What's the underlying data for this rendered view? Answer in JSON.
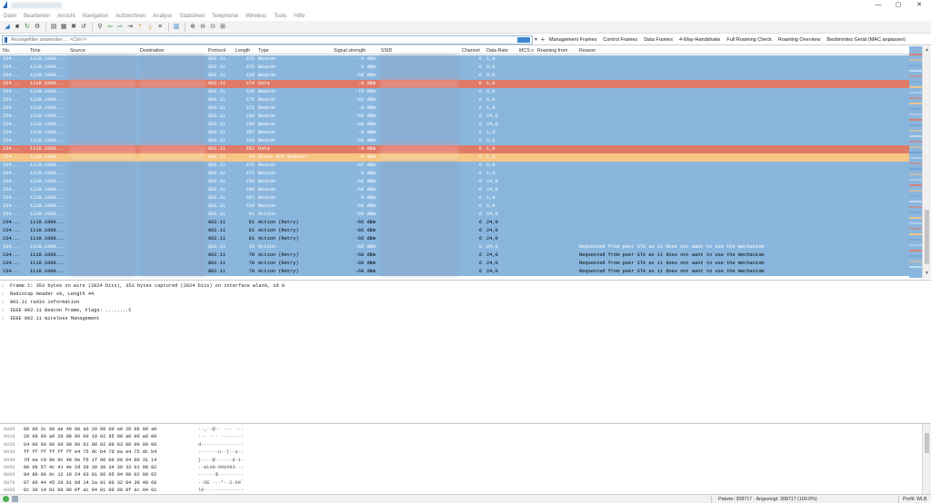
{
  "window": {
    "controls": {
      "minimize": "—",
      "maximize": "▢",
      "close": "✕"
    }
  },
  "menu": [
    "Datei",
    "Bearbeiten",
    "Ansicht",
    "Navigation",
    "Aufzeichnen",
    "Analyse",
    "Statistiken",
    "Telephonie",
    "Wireless",
    "Tools",
    "Hilfe"
  ],
  "toolbar": {
    "icons": [
      "shark-fin-icon",
      "stop-icon",
      "restart-icon",
      "options-gear-icon",
      "open-file-icon",
      "save-file-icon",
      "close-file-icon",
      "reload-icon",
      "find-icon",
      "go-back-icon",
      "go-forward-icon",
      "go-to-packet-icon",
      "go-first-icon",
      "go-last-icon",
      "autoscroll-icon",
      "colorize-icon",
      "zoom-in-icon",
      "zoom-out-icon",
      "zoom-reset-icon",
      "resize-columns-icon"
    ],
    "glyphs": [
      "◢",
      "■",
      "↻",
      "⚙",
      "▤",
      "▦",
      "✖",
      "↺",
      "⚲",
      "⇦",
      "⇨",
      "⇥",
      "⤒",
      "⤓",
      "≡",
      "▥",
      "⊕",
      "⊖",
      "⊙",
      "⊞"
    ]
  },
  "filter": {
    "placeholder": "Anzeigefilter anwenden ... <Ctrl-/>",
    "dropdown": "▾",
    "add": "+",
    "buttons": [
      "Management Frames",
      "Control Frames",
      "Data Frames",
      "4-Way-Handshake",
      "Full Roaming Check",
      "Roaming Overview",
      "Bestimmtes Gerät (MAC anpassen)"
    ]
  },
  "columns": [
    "No.",
    "Time",
    "Source",
    "Destination",
    "Protocol",
    "Length",
    "Type",
    "Signal strength",
    "SSID",
    "Channel",
    "Data Rate",
    "MCS x",
    "Roaming from",
    "Reason"
  ],
  "colors": {
    "light_blue_bg": "#8ab6de",
    "light_blue_fg": "#ffffff",
    "red_bg": "#e07a68",
    "red_fg": "#ffffff",
    "orange_bg": "#f6c583",
    "orange_fg": "#ffffff",
    "dark_blue_bg": "#8ab6de",
    "dark_blue_fg": "#000000"
  },
  "packets": [
    {
      "no": "234...",
      "time": "1118.1000...",
      "proto": "802.11",
      "len": "372",
      "type": "Beacon",
      "sig": "-6 dBm",
      "ch": "6",
      "rate": "1,0",
      "reason": "",
      "style": "light_blue"
    },
    {
      "no": "234...",
      "time": "1118.1000...",
      "proto": "802.11",
      "len": "375",
      "type": "Beacon",
      "sig": "-0 dBm",
      "ch": "6",
      "rate": "6,0",
      "reason": "",
      "style": "light_blue"
    },
    {
      "no": "234...",
      "time": "1118.1000...",
      "proto": "802.11",
      "len": "319",
      "type": "Beacon",
      "sig": "-66 dBm",
      "ch": "6",
      "rate": "6,0",
      "reason": "",
      "style": "light_blue"
    },
    {
      "no": "234...",
      "time": "1118.1000...",
      "proto": "802.11",
      "len": "174",
      "type": "Data",
      "sig": "-0 dBm",
      "ch": "6",
      "rate": "1,0",
      "reason": "",
      "style": "red"
    },
    {
      "no": "234...",
      "time": "1118.1000...",
      "proto": "802.11",
      "len": "328",
      "type": "Beacon",
      "sig": "-75 dBm",
      "ch": "6",
      "rate": "6,0",
      "reason": "",
      "style": "light_blue"
    },
    {
      "no": "234...",
      "time": "1118.1000...",
      "proto": "802.11",
      "len": "375",
      "type": "Beacon",
      "sig": "-82 dBm",
      "ch": "6",
      "rate": "6,0",
      "reason": "",
      "style": "light_blue"
    },
    {
      "no": "234...",
      "time": "1118.1000...",
      "proto": "802.11",
      "len": "371",
      "type": "Beacon",
      "sig": "-0 dBm",
      "ch": "6",
      "rate": "1,0",
      "reason": "",
      "style": "light_blue"
    },
    {
      "no": "234...",
      "time": "1118.1000...",
      "proto": "802.11",
      "len": "258",
      "type": "Beacon",
      "sig": "-66 dBm",
      "ch": "6",
      "rate": "24,0",
      "reason": "",
      "style": "light_blue"
    },
    {
      "no": "234...",
      "time": "1118.1000...",
      "proto": "802.11",
      "len": "298",
      "type": "Beacon",
      "sig": "-68 dBm",
      "ch": "6",
      "rate": "24,0",
      "reason": "",
      "style": "light_blue"
    },
    {
      "no": "234...",
      "time": "1118.1000...",
      "proto": "802.11",
      "len": "387",
      "type": "Beacon",
      "sig": "-0 dBm",
      "ch": "6",
      "rate": "1,0",
      "reason": "",
      "style": "light_blue"
    },
    {
      "no": "234...",
      "time": "1118.1000...",
      "proto": "802.11",
      "len": "319",
      "type": "Beacon",
      "sig": "-66 dBm",
      "ch": "6",
      "rate": "6,0",
      "reason": "",
      "style": "light_blue"
    },
    {
      "no": "234...",
      "time": "1118.1000...",
      "proto": "802.11",
      "len": "252",
      "type": "Data",
      "sig": "-0 dBm",
      "ch": "6",
      "rate": "1,0",
      "reason": "",
      "style": "red"
    },
    {
      "no": "234...",
      "time": "1118.1000...",
      "proto": "802.11",
      "len": "44",
      "type": "Block Ack Request",
      "sig": "-0 dBm",
      "ch": "6",
      "rate": "1,0",
      "reason": "",
      "style": "orange"
    },
    {
      "no": "234...",
      "time": "1118.1000...",
      "proto": "802.11",
      "len": "375",
      "type": "Beacon",
      "sig": "-82 dBm",
      "ch": "6",
      "rate": "6,0",
      "reason": "",
      "style": "light_blue"
    },
    {
      "no": "234...",
      "time": "1118.1000...",
      "proto": "802.11",
      "len": "371",
      "type": "Beacon",
      "sig": "-0 dBm",
      "ch": "6",
      "rate": "1,0",
      "reason": "",
      "style": "light_blue"
    },
    {
      "no": "234...",
      "time": "1118.1000...",
      "proto": "802.11",
      "len": "258",
      "type": "Beacon",
      "sig": "-66 dBm",
      "ch": "6",
      "rate": "24,0",
      "reason": "",
      "style": "light_blue"
    },
    {
      "no": "234...",
      "time": "1118.1000...",
      "proto": "802.11",
      "len": "298",
      "type": "Beacon",
      "sig": "-68 dBm",
      "ch": "6",
      "rate": "24,0",
      "reason": "",
      "style": "light_blue"
    },
    {
      "no": "234...",
      "time": "1118.1000...",
      "proto": "802.11",
      "len": "387",
      "type": "Beacon",
      "sig": "-0 dBm",
      "ch": "6",
      "rate": "1,0",
      "reason": "",
      "style": "light_blue"
    },
    {
      "no": "234...",
      "time": "1118.1000...",
      "proto": "802.11",
      "len": "319",
      "type": "Beacon",
      "sig": "-66 dBm",
      "ch": "6",
      "rate": "6,0",
      "reason": "",
      "style": "light_blue"
    },
    {
      "no": "234...",
      "time": "1118.1000...",
      "proto": "802.11",
      "len": "81",
      "type": "Action",
      "sig": "-66 dBm",
      "ch": "6",
      "rate": "24,0",
      "reason": "",
      "style": "light_blue"
    },
    {
      "no": "234...",
      "time": "1118.1000...",
      "proto": "802.11",
      "len": "81",
      "type": "Action (Retry)",
      "sig": "-66 dBm",
      "ch": "6",
      "rate": "24,0",
      "reason": "",
      "style": "dark_blue"
    },
    {
      "no": "234...",
      "time": "1118.1000...",
      "proto": "802.11",
      "len": "81",
      "type": "Action (Retry)",
      "sig": "-66 dBm",
      "ch": "6",
      "rate": "24,0",
      "reason": "",
      "style": "dark_blue"
    },
    {
      "no": "234...",
      "time": "1118.1000...",
      "proto": "802.11",
      "len": "81",
      "type": "Action (Retry)",
      "sig": "-66 dBm",
      "ch": "6",
      "rate": "24,0",
      "reason": "",
      "style": "dark_blue"
    },
    {
      "no": "234...",
      "time": "1118.1000...",
      "proto": "802.11",
      "len": "78",
      "type": "Action",
      "sig": "-66 dBm",
      "ch": "6",
      "rate": "24,0",
      "reason": "Requested from peer STA as it does not want to use the mechanism",
      "style": "light_blue"
    },
    {
      "no": "234...",
      "time": "1118.1000...",
      "proto": "802.11",
      "len": "78",
      "type": "Action (Retry)",
      "sig": "-68 dBm",
      "ch": "6",
      "rate": "24,0",
      "reason": "Requested from peer STA as it does not want to use the mechanism",
      "style": "dark_blue"
    },
    {
      "no": "234...",
      "time": "1118.1000...",
      "proto": "802.11",
      "len": "78",
      "type": "Action (Retry)",
      "sig": "-68 dBm",
      "ch": "6",
      "rate": "24,0",
      "reason": "Requested from peer STA as it does not want to use the mechanism",
      "style": "dark_blue"
    },
    {
      "no": "234...",
      "time": "1118.1000...",
      "proto": "802.11",
      "len": "78",
      "type": "Action (Retry)",
      "sig": "-68 dBm",
      "ch": "6",
      "rate": "24,0",
      "reason": "Requested from peer STA as it does not want to use the mechanism",
      "style": "dark_blue"
    }
  ],
  "details": [
    "Frame 1: 353 bytes on wire (2824 bits), 353 bytes captured (2824 bits) on interface wlan0, id 0",
    "Radiotap Header v0, Length 44",
    "802.11 radio information",
    "IEEE 802.11 Beacon frame, Flags: ........C",
    "IEEE 802.11 Wireless Management"
  ],
  "details_arrow": "›",
  "bytes": [
    {
      "off": "0000",
      "hex": "00 00 2c 00 ae 40 00 a0  20 08 00 a0 20 08 00 a0",
      "ascii": "··,··@·· ··· ···"
    },
    {
      "off": "0010",
      "hex": "20 08 00 a0 20 08 00 00  10 02 85 09 a0 00 a8 00",
      "ascii": " ··· ··· ········"
    },
    {
      "off": "0020",
      "hex": "64 00 00 00 00 00 00 01  00 02 00 03 00 00 00 00",
      "ascii": "d···············"
    },
    {
      "off": "0030",
      "hex": "ff ff ff ff ff ff e4 75  dc b4 7d ea e4 75 dc b4",
      "ascii": "·······u··}··u··"
    },
    {
      "off": "0040",
      "hex": "7d ea c0 9e 0c 40 0e f6  1f 00 00 00 64 00 31 14",
      "ascii": "}····@······d·1·"
    },
    {
      "off": "0050",
      "hex": "00 0b 57 4c 41 4e 2d 39  30 38 34 39 33 01 08 82",
      "ascii": "··WLAN-908493···"
    },
    {
      "off": "0060",
      "hex": "84 8b 96 0c 12 18 24 03  01 06 05 04 00 02 00 02",
      "ascii": "······$·········"
    },
    {
      "off": "0070",
      "hex": "07 06 44 45 20 01 0d 14  2a 01 00 32 04 30 48 60",
      "ascii": "··DE ···*··2·0H`"
    },
    {
      "off": "0080",
      "hex": "6c 30 14 01 00 00 0f ac  04 01 00 00 0f ac 04 01",
      "ascii": "l0··············"
    }
  ],
  "status": {
    "packets": "Pakete: 308717 · Angezeigt: 308717 (100.0%)",
    "profile": "Profil: WLB"
  }
}
